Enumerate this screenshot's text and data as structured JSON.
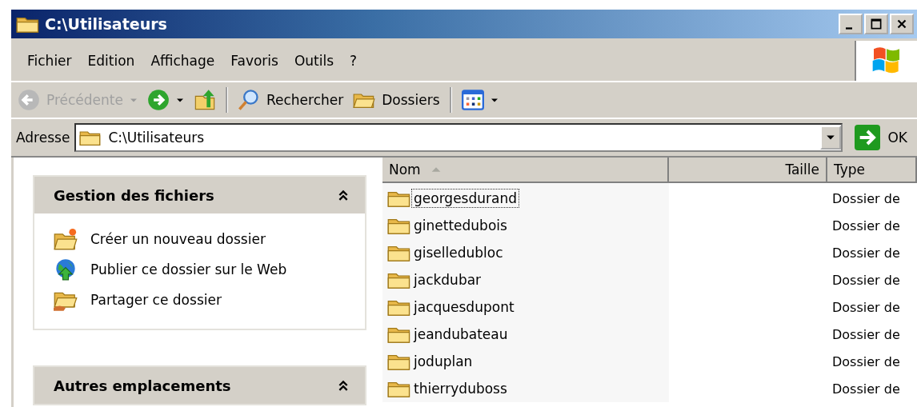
{
  "window": {
    "title": "C:\\Utilisateurs"
  },
  "menu": [
    "Fichier",
    "Edition",
    "Affichage",
    "Favoris",
    "Outils",
    "?"
  ],
  "toolbar": [
    {
      "kind": "back",
      "label": "Précédente",
      "disabled": true
    },
    {
      "kind": "forward",
      "disabled": false
    },
    {
      "kind": "up",
      "disabled": false
    },
    {
      "kind": "separator"
    },
    {
      "kind": "search",
      "label": "Rechercher",
      "disabled": false
    },
    {
      "kind": "folders",
      "label": "Dossiers",
      "disabled": false
    },
    {
      "kind": "separator"
    },
    {
      "kind": "views",
      "disabled": false
    }
  ],
  "address": {
    "label": "Adresse",
    "value": "C:\\Utilisateurs",
    "go": "OK"
  },
  "panels": [
    {
      "title": "Gestion des fichiers",
      "expanded": true,
      "items": [
        {
          "kind": "new-folder",
          "label": "Créer un nouveau dossier"
        },
        {
          "kind": "publish",
          "label": "Publier ce dossier sur le Web"
        },
        {
          "kind": "share",
          "label": "Partager ce dossier"
        }
      ]
    },
    {
      "title": "Autres emplacements",
      "expanded": true
    }
  ],
  "table": {
    "columns": [
      {
        "label": "Nom",
        "sorted": true
      },
      {
        "label": "Taille",
        "sorted": false
      },
      {
        "label": "Type",
        "sorted": false
      }
    ],
    "rows": [
      {
        "name": "georgesdurand",
        "type": "Dossier de",
        "focused": true
      },
      {
        "name": "ginettedubois",
        "type": "Dossier de",
        "focused": false
      },
      {
        "name": "giselledubloc",
        "type": "Dossier de",
        "focused": false
      },
      {
        "name": "jackdubar",
        "type": "Dossier de",
        "focused": false
      },
      {
        "name": "jacquesdupont",
        "type": "Dossier de",
        "focused": false
      },
      {
        "name": "jeandubateau",
        "type": "Dossier de",
        "focused": false
      },
      {
        "name": "joduplan",
        "type": "Dossier de",
        "focused": false
      },
      {
        "name": "thierryduboss",
        "type": "Dossier de",
        "focused": false
      }
    ]
  }
}
